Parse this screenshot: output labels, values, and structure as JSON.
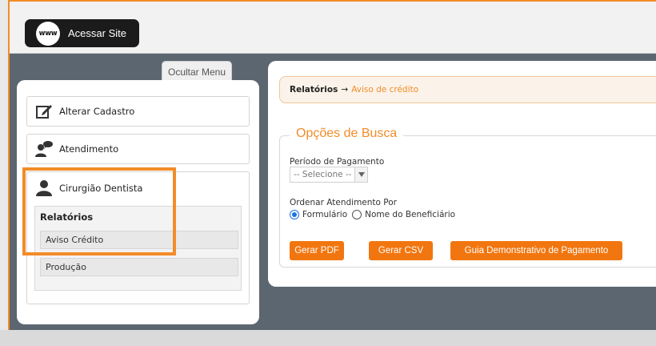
{
  "header": {
    "site_button_label": "Acessar Site",
    "site_icon_text": "www"
  },
  "sidebar": {
    "hide_menu_label": "Ocultar Menu",
    "items": [
      {
        "label": "Alterar Cadastro",
        "icon": "edit-icon"
      },
      {
        "label": "Atendimento",
        "icon": "chat-person-icon"
      },
      {
        "label": "Cirurgião Dentista",
        "icon": "person-icon"
      }
    ],
    "submenu": {
      "heading": "Relatórios",
      "links": [
        "Aviso Crédito",
        "Produção"
      ]
    }
  },
  "main": {
    "breadcrumb": {
      "root": "Relatórios",
      "arrow": "→",
      "current": "Aviso de crédito"
    },
    "search": {
      "legend": "Opções de Busca",
      "period_label": "Período de Pagamento",
      "period_value": "-- Selecione --",
      "order_label": "Ordenar Atendimento Por",
      "order_options": [
        {
          "label": "Formulário",
          "selected": true
        },
        {
          "label": "Nome do Beneficiário",
          "selected": false
        }
      ],
      "buttons": [
        "Gerar PDF",
        "Gerar CSV",
        "Guia Demonstrativo de Pagamento"
      ]
    }
  },
  "colors": {
    "accent": "#f28c28",
    "button": "#f2760f",
    "backdrop": "#5b6670"
  }
}
